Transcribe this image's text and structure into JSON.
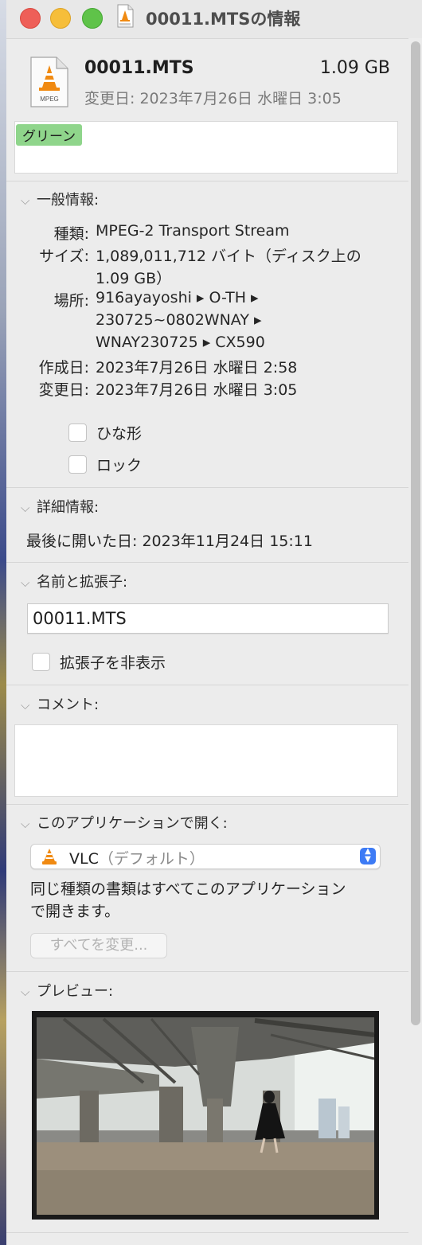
{
  "window": {
    "title": "00011.MTSの情報"
  },
  "header": {
    "file_name": "00011.MTS",
    "file_size": "1.09 GB",
    "modified": "変更日: 2023年7月26日 水曜日 3:05",
    "icon_label": "MPEG"
  },
  "tags": [
    "グリーン"
  ],
  "general": {
    "heading": "一般情報:",
    "rows": [
      {
        "label": "種類:",
        "value": "MPEG-2 Transport Stream"
      },
      {
        "label": "サイズ:",
        "value": "1,089,011,712 バイト（ディスク上の",
        "value2": "1.09 GB）"
      },
      {
        "label": "場所:",
        "value": "916ayayoshi ▸ O-TH ▸",
        "value2": "230725~0802WNAY ▸",
        "value3": "WNAY230725 ▸ CX590"
      },
      {
        "label": "作成日:",
        "value": "2023年7月26日 水曜日 2:58"
      },
      {
        "label": "変更日:",
        "value": "2023年7月26日 水曜日 3:05"
      }
    ],
    "stationery": "ひな形",
    "locked": "ロック"
  },
  "more_info": {
    "heading": "詳細情報:",
    "last_opened": "最後に開いた日: 2023年11月24日 15:11"
  },
  "name_ext": {
    "heading": "名前と拡張子:",
    "value": "00011.MTS",
    "hide_ext": "拡張子を非表示"
  },
  "comments": {
    "heading": "コメント:"
  },
  "open_with": {
    "heading": "このアプリケーションで開く:",
    "app": "VLC",
    "app_sub": "（デフォルト）",
    "note_line1": "同じ種類の書類はすべてこのアプリケーション",
    "note_line2": "で開きます。",
    "change_all": "すべてを変更..."
  },
  "preview": {
    "heading": "プレビュー:"
  },
  "colors": {
    "tag_green": "#8fd58b",
    "accent_blue": "#3d7bf5"
  }
}
